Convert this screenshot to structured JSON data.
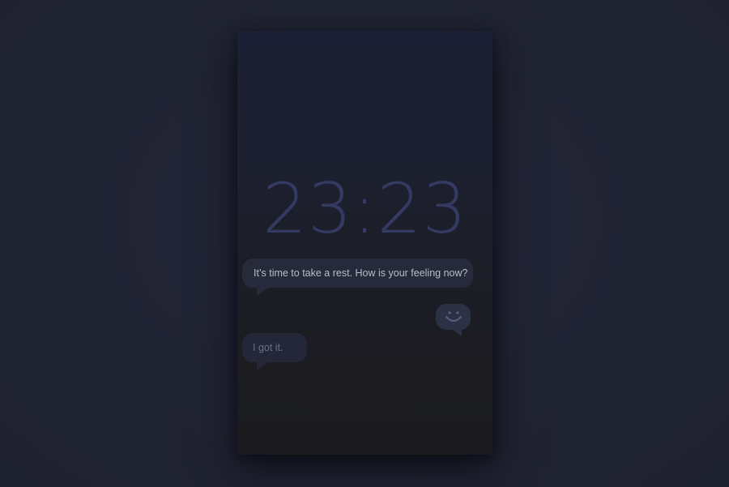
{
  "clock": {
    "time": "23:23"
  },
  "messages": [
    {
      "from": "app",
      "text": "It’s time to take a rest. How is your feeling now?"
    },
    {
      "from": "user",
      "icon": "smiley-face-icon"
    },
    {
      "from": "user",
      "text": "I got it."
    }
  ],
  "colors": {
    "background": "#232635",
    "screen_top": "#1c2034",
    "screen_bottom": "#1b1b1d",
    "clock_text": "#353a63",
    "bubble": "#262a3b",
    "bubble_text": "#b8bccb",
    "reply_text": "#6c7083",
    "emoji_stroke": "#5a6187"
  }
}
